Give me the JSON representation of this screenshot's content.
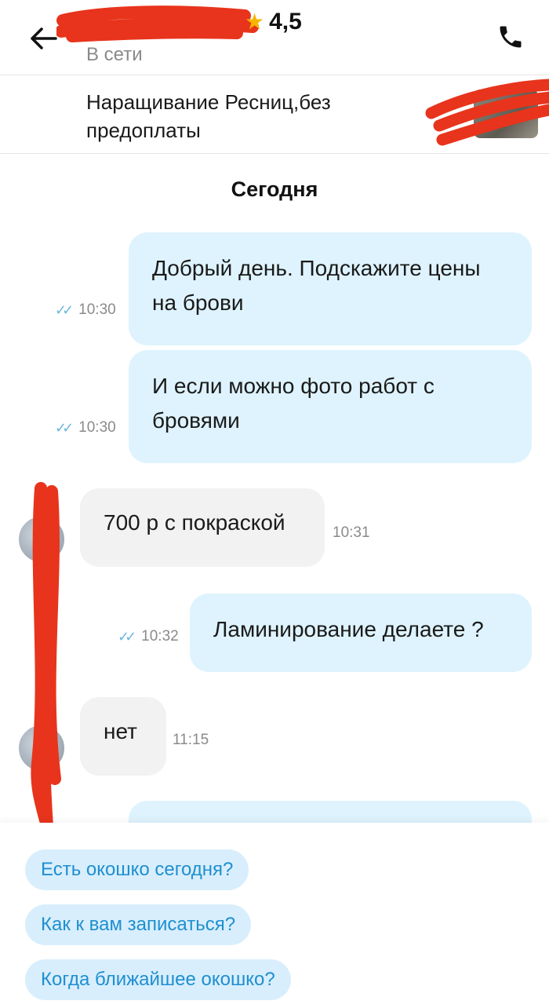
{
  "header": {
    "contact_name": "",
    "rating": "4,5",
    "status": "В сети",
    "back_icon": "arrow-left-icon",
    "call_icon": "phone-icon"
  },
  "ad": {
    "title": "Наращивание Ресниц,без предоплаты"
  },
  "chat": {
    "date_separator": "Сегодня",
    "messages": [
      {
        "direction": "out",
        "text": "Добрый день. Подскажите цены на брови",
        "time": "10:30",
        "read": true
      },
      {
        "direction": "out",
        "text": "И если можно фото работ с бровями",
        "time": "10:30",
        "read": true
      },
      {
        "direction": "in",
        "text": "700 р с покраской",
        "time": "10:31"
      },
      {
        "direction": "out",
        "text": "Ламинирование делаете ?",
        "time": "10:32",
        "read": true
      },
      {
        "direction": "in",
        "text": "нет",
        "time": "11:15"
      }
    ]
  },
  "quick_replies": [
    "Есть окошко сегодня?",
    "Как к вам записаться?",
    "Когда ближайшее окошко?"
  ],
  "colors": {
    "outgoing_bubble": "#def3fd",
    "incoming_bubble": "#f2f2f2",
    "chip_bg": "#d8eefc",
    "chip_text": "#1e8fd0",
    "star": "#f7b500",
    "read_ticks": "#6bb7e0",
    "redaction": "#e8341c"
  }
}
